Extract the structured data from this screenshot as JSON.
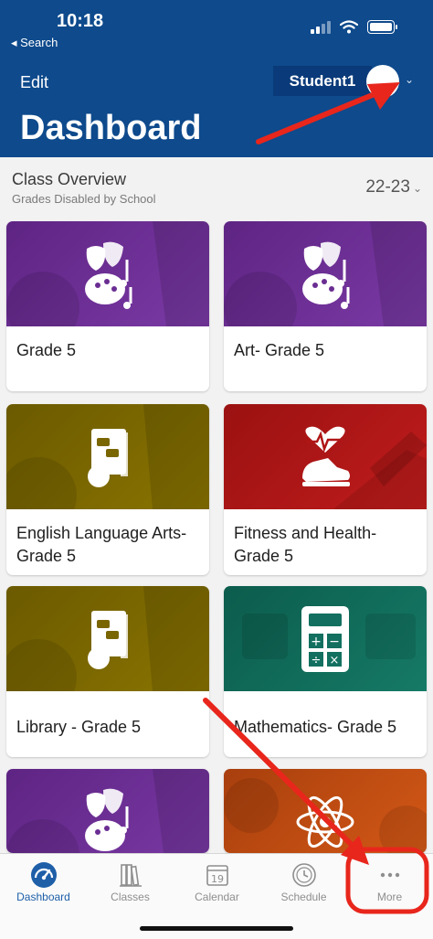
{
  "status_bar": {
    "time": "10:18",
    "back_label": "◂ Search",
    "icons": [
      "signal-icon",
      "wifi-icon",
      "battery-icon"
    ]
  },
  "header": {
    "edit_label": "Edit",
    "student_name": "Student1",
    "title": "Dashboard",
    "background_color": "#0e4a8c"
  },
  "overview": {
    "title": "Class Overview",
    "subtitle": "Grades Disabled by School",
    "year": "22-23"
  },
  "classes": [
    {
      "label": "Grade 5",
      "theme": "purple",
      "icon": "arts-icon"
    },
    {
      "label": "Art- Grade 5",
      "theme": "purple",
      "icon": "arts-icon"
    },
    {
      "label": "English Language Arts- Grade 5",
      "theme": "olive",
      "icon": "reading-icon"
    },
    {
      "label": "Fitness and Health- Grade 5",
      "theme": "red",
      "icon": "heart-sneaker-icon"
    },
    {
      "label": "Library - Grade 5",
      "theme": "olive",
      "icon": "reading-icon"
    },
    {
      "label": "Mathematics- Grade 5",
      "theme": "teal",
      "icon": "calculator-icon"
    },
    {
      "label": "",
      "theme": "purple",
      "icon": "arts-icon"
    },
    {
      "label": "",
      "theme": "orange",
      "icon": "atom-icon"
    }
  ],
  "tabbar": {
    "tabs": [
      {
        "label": "Dashboard",
        "icon": "dashboard-gauge-icon",
        "active": true
      },
      {
        "label": "Classes",
        "icon": "books-icon",
        "active": false
      },
      {
        "label": "Calendar",
        "icon": "calendar-icon",
        "calendar_day": "19",
        "active": false
      },
      {
        "label": "Schedule",
        "icon": "clock-icon",
        "active": false
      },
      {
        "label": "More",
        "icon": "more-dots-icon",
        "active": false
      }
    ]
  },
  "annotations": {
    "color": "#e8261c",
    "items": [
      "arrow pointing to student selector",
      "arrow pointing to More tab",
      "circle around More tab"
    ]
  }
}
